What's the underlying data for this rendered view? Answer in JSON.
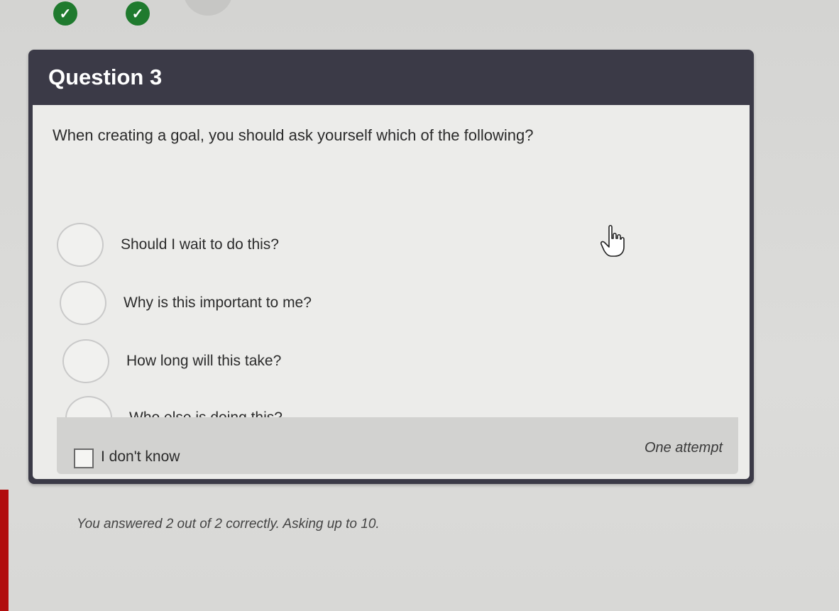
{
  "progress": {
    "completed_mark": "✓"
  },
  "question": {
    "header": "Question 3",
    "prompt": "When creating a goal, you should ask yourself which of the following?",
    "options": [
      {
        "label": "Should I wait to do this?"
      },
      {
        "label": "Why is this important to me?"
      },
      {
        "label": "How long will this take?"
      },
      {
        "label": "Who else is doing this?"
      }
    ],
    "dont_know_label": "I don't know",
    "attempt_label": "One attempt"
  },
  "status": {
    "score_text": "You answered 2 out of 2 correctly. Asking up to 10."
  },
  "colors": {
    "header_bg": "#3b3a47",
    "correct_dot": "#1f7a2e"
  }
}
